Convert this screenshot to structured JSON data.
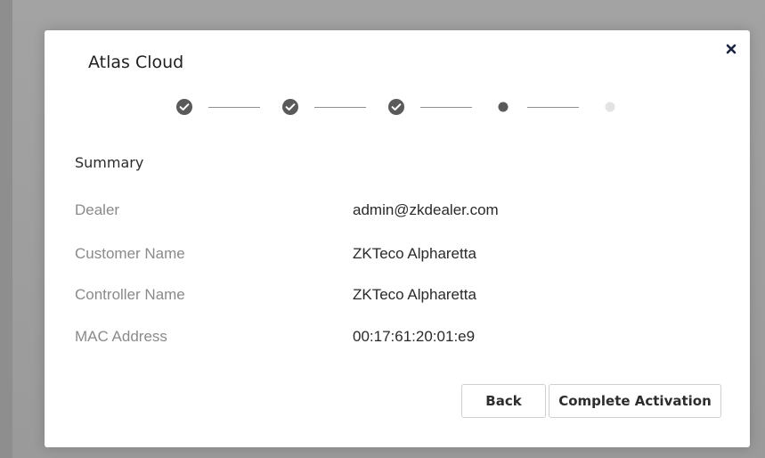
{
  "modal": {
    "title": "Atlas Cloud",
    "close_icon": "close-icon"
  },
  "stepper": {
    "steps": [
      {
        "state": "completed",
        "icon": "check-circle-icon"
      },
      {
        "state": "completed",
        "icon": "check-circle-icon"
      },
      {
        "state": "completed",
        "icon": "check-circle-icon"
      },
      {
        "state": "active",
        "icon": "dot-icon"
      },
      {
        "state": "pending",
        "icon": "dot-icon"
      }
    ]
  },
  "summary": {
    "title": "Summary",
    "rows": [
      {
        "label": "Dealer",
        "value": "admin@zkdealer.com"
      },
      {
        "label": "Customer Name",
        "value": "ZKTeco Alpharetta"
      },
      {
        "label": "Controller Name",
        "value": "ZKTeco Alpharetta"
      },
      {
        "label": "MAC Address",
        "value": "00:17:61:20:01:e9"
      }
    ]
  },
  "actions": {
    "back_label": "Back",
    "complete_label": "Complete Activation"
  },
  "colors": {
    "step_completed": "#5a5a5a",
    "step_active": "#5a5a5a",
    "step_pending": "#e3e3e3",
    "close_icon": "#1a2340"
  }
}
